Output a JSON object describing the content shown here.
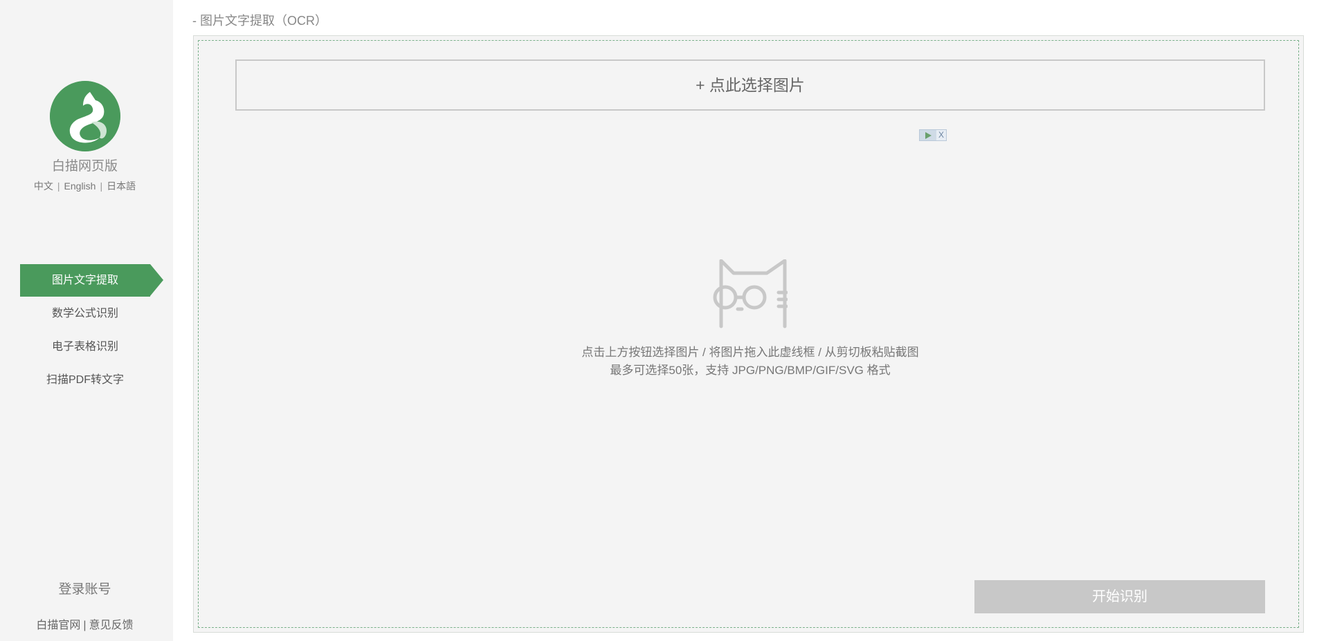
{
  "brand": {
    "name": "白描网页版"
  },
  "languages": [
    "中文",
    "English",
    "日本語"
  ],
  "lang_separator": "|",
  "nav": {
    "items": [
      {
        "label": "图片文字提取",
        "active": true
      },
      {
        "label": "数学公式识别",
        "active": false
      },
      {
        "label": "电子表格识别",
        "active": false
      },
      {
        "label": "扫描PDF转文字",
        "active": false
      }
    ]
  },
  "sidebar_footer": {
    "login": "登录账号",
    "links": [
      "白描官网",
      "意见反馈"
    ],
    "separator": "|"
  },
  "main": {
    "title": "- 图片文字提取（OCR）",
    "select_button": "+ 点此选择图片",
    "ad_close": "X",
    "hint_line1": "点击上方按钮选择图片 / 将图片拖入此虚线框 / 从剪切板粘贴截图",
    "hint_line2": "最多可选择50张，支持 JPG/PNG/BMP/GIF/SVG 格式",
    "start_button": "开始识别"
  },
  "colors": {
    "accent": "#4a9a5c",
    "panel_bg": "#f4f4f4",
    "disabled_button": "#c8c8c8"
  },
  "icons": {
    "logo": "cat-logo-icon",
    "placeholder": "cat-glasses-icon",
    "ad": "ad-play-icon"
  }
}
